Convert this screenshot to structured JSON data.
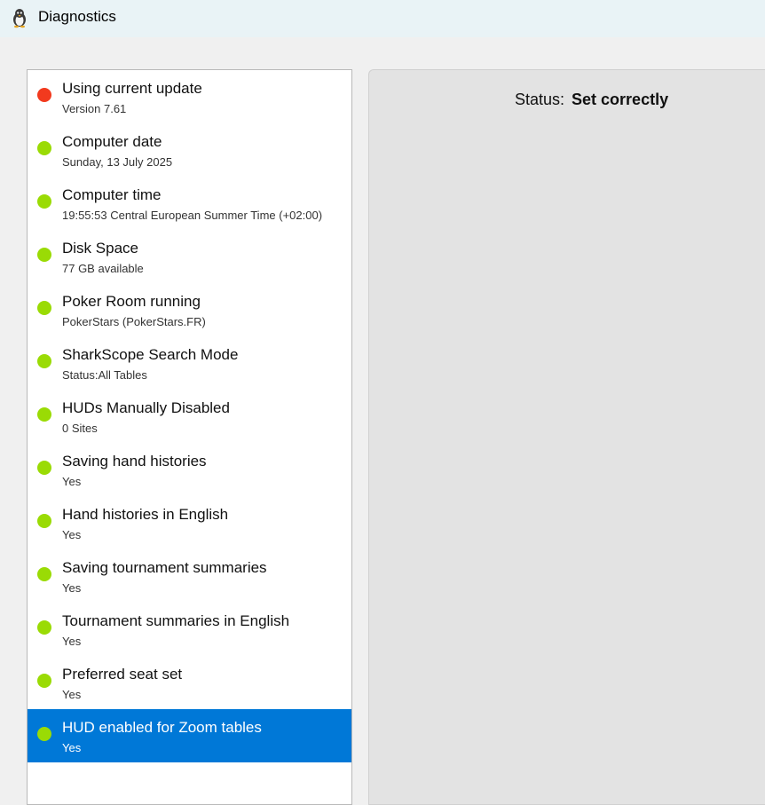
{
  "window": {
    "title": "Diagnostics",
    "icon": "penguin-app-icon"
  },
  "colors": {
    "error": "#f23a1e",
    "ok": "#9adb05",
    "selected": "#0078d7"
  },
  "checks": [
    {
      "title": "Using current update",
      "subtitle": "Version 7.61",
      "status": "error"
    },
    {
      "title": "Computer date",
      "subtitle": "Sunday, 13 July 2025",
      "status": "ok"
    },
    {
      "title": "Computer time",
      "subtitle": "19:55:53 Central European Summer Time (+02:00)",
      "status": "ok"
    },
    {
      "title": "Disk Space",
      "subtitle": "77 GB available",
      "status": "ok"
    },
    {
      "title": "Poker Room running",
      "subtitle": "PokerStars (PokerStars.FR)",
      "status": "ok"
    },
    {
      "title": "SharkScope Search Mode",
      "subtitle": "Status:All Tables",
      "status": "ok"
    },
    {
      "title": "HUDs Manually Disabled",
      "subtitle": "0 Sites",
      "status": "ok"
    },
    {
      "title": "Saving hand histories",
      "subtitle": "Yes",
      "status": "ok"
    },
    {
      "title": "Hand histories in English",
      "subtitle": "Yes",
      "status": "ok"
    },
    {
      "title": "Saving tournament summaries",
      "subtitle": "Yes",
      "status": "ok"
    },
    {
      "title": "Tournament summaries in English",
      "subtitle": "Yes",
      "status": "ok"
    },
    {
      "title": "Preferred seat set",
      "subtitle": "Yes",
      "status": "ok"
    },
    {
      "title": "HUD enabled for Zoom tables",
      "subtitle": "Yes",
      "status": "ok",
      "selected": true
    }
  ],
  "detail": {
    "status_label": "Status:",
    "status_value": "Set correctly"
  }
}
